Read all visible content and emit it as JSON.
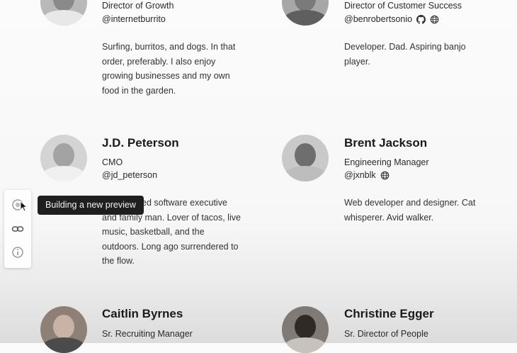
{
  "people": [
    {
      "role": "Director of Growth",
      "handle": "@internetburrito",
      "bio": "Surfing, burritos, and dogs. In that order, preferably. I also enjoy growing businesses and my own food in the garden."
    },
    {
      "role": "Director of Customer Success",
      "handle": "@benrobertsonio",
      "bio": "Developer. Dad. Aspiring banjo player."
    },
    {
      "name": "J.D. Peterson",
      "role": "CMO",
      "handle": "@jd_peterson",
      "bio": "ed software executive and family man. Lover of tacos, live music, basketball, and the outdoors. Long ago surrendered to the flow."
    },
    {
      "name": "Brent Jackson",
      "role": "Engineering Manager",
      "handle": "@jxnblk",
      "bio": "Web developer and designer. Cat whisperer. Avid walker."
    },
    {
      "name": "Caitlin Byrnes",
      "role": "Sr. Recruiting Manager"
    },
    {
      "name": "Christine Egger",
      "role": "Sr. Director of People"
    }
  ],
  "tooltip": "Building a new preview",
  "icons": {
    "github": "github-icon",
    "globe": "globe-icon",
    "preview": "preview-icon",
    "link": "link-icon",
    "info": "info-icon",
    "cursor": "cursor-icon"
  }
}
